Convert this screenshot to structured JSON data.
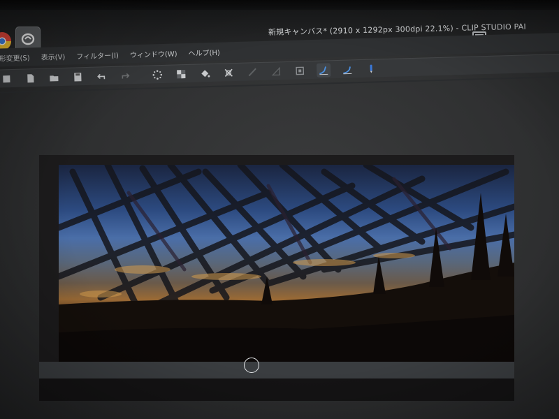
{
  "window": {
    "title": "新規キャンバス* (2910 x 1292px 300dpi 22.1%) - CLIP STUDIO PAI"
  },
  "taskbar": {
    "icons": [
      "chrome-icon",
      "clip-studio-icon"
    ]
  },
  "menubar": {
    "items": [
      {
        "label": "形変更(S)"
      },
      {
        "label": "表示(V)"
      },
      {
        "label": "フィルター(I)"
      },
      {
        "label": "ウィンドウ(W)"
      },
      {
        "label": "ヘルプ(H)"
      }
    ],
    "icons": [
      "sparkle-icon",
      "transparency-icon",
      "fill-icon",
      "transform-icon",
      "ruler-icon",
      "ruler-icon",
      "frame-icon",
      "pen-pressure-icon",
      "pen-pressure-icon",
      "pen-icon"
    ]
  },
  "commandbar": {
    "icons": [
      "new-canvas-icon",
      "new-page-icon",
      "open-icon",
      "save-icon",
      "undo-icon",
      "redo-icon"
    ]
  },
  "top_right": {
    "icons": [
      "workspace-layout-icon",
      "chevron-down-icon"
    ]
  },
  "colors": {
    "bg": "#2e2f30",
    "sky_top": "#2c4a80",
    "sky_bright": "#4a6ea8",
    "sunset": "#9a6a35",
    "ground": "#120c08"
  }
}
